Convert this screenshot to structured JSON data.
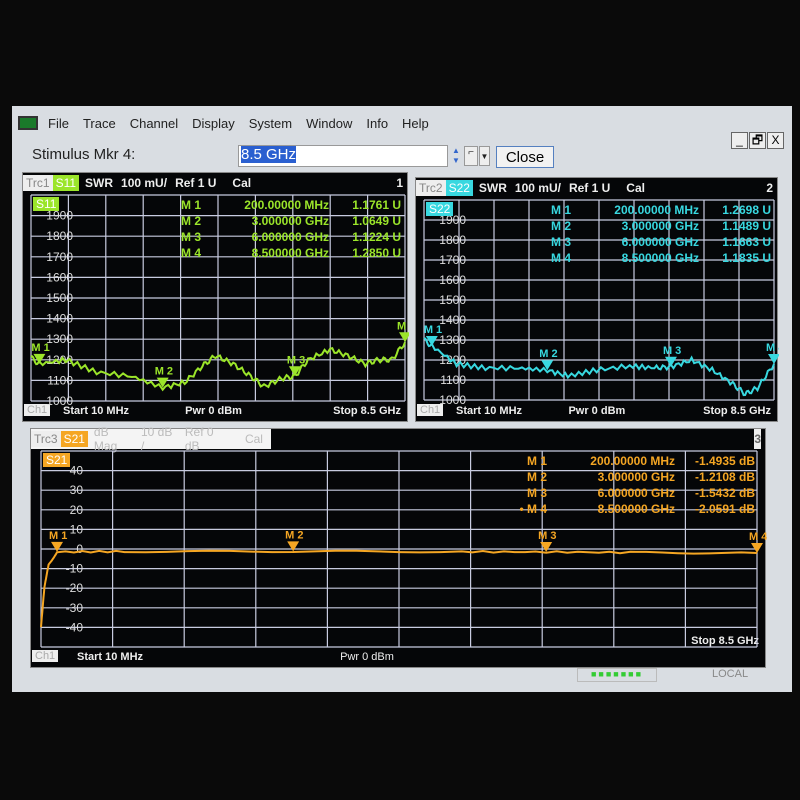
{
  "menu": {
    "items": [
      "File",
      "Trace",
      "Channel",
      "Display",
      "System",
      "Window",
      "Info",
      "Help"
    ]
  },
  "window_controls": {
    "minimize": "_",
    "restore": "🗗",
    "close": "X"
  },
  "toolbar": {
    "label": "Stimulus Mkr 4:",
    "value": "8.5 GHz",
    "close_label": "Close"
  },
  "panels": [
    {
      "trace": "Trc1",
      "param": "S11",
      "format": "SWR",
      "scale": "100 mU/",
      "ref": "Ref 1 U",
      "cal": "Cal",
      "number": "1",
      "color": "#9be52a",
      "yticks": [
        "1900",
        "1800",
        "1700",
        "1600",
        "1500",
        "1400",
        "1300",
        "1200",
        "1100",
        "1000"
      ],
      "markers": [
        {
          "name": "M 1",
          "stim": "200.00000 MHz",
          "value": "1.1761 U"
        },
        {
          "name": "M 2",
          "stim": "3.000000 GHz",
          "value": "1.0649 U"
        },
        {
          "name": "M 3",
          "stim": "6.000000 GHz",
          "value": "1.1224 U"
        },
        {
          "name": "M 4",
          "stim": "8.500000 GHz",
          "value": "1.2850 U"
        }
      ],
      "footer": {
        "ch": "Ch1",
        "start": "Start  10 MHz",
        "pwr": "Pwr  0 dBm",
        "stop": "Stop  8.5 GHz"
      }
    },
    {
      "trace": "Trc2",
      "param": "S22",
      "format": "SWR",
      "scale": "100 mU/",
      "ref": "Ref 1 U",
      "cal": "Cal",
      "number": "2",
      "color": "#38d8e0",
      "yticks": [
        "1900",
        "1800",
        "1700",
        "1600",
        "1500",
        "1400",
        "1300",
        "1200",
        "1100",
        "1000"
      ],
      "markers": [
        {
          "name": "M 1",
          "stim": "200.00000 MHz",
          "value": "1.2698 U"
        },
        {
          "name": "M 2",
          "stim": "3.000000 GHz",
          "value": "1.1489 U"
        },
        {
          "name": "M 3",
          "stim": "6.000000 GHz",
          "value": "1.1663 U"
        },
        {
          "name": "M 4",
          "stim": "8.500000 GHz",
          "value": "1.1835 U"
        }
      ],
      "footer": {
        "ch": "Ch1",
        "start": "Start  10 MHz",
        "pwr": "Pwr  0 dBm",
        "stop": "Stop  8.5 GHz"
      }
    },
    {
      "trace": "Trc3",
      "param": "S21",
      "format": "dB Mag",
      "scale": "10 dB /",
      "ref": "Ref 0 dB",
      "cal": "Cal",
      "number": "3",
      "color": "#f5a623",
      "yticks": [
        "40",
        "30",
        "20",
        "10",
        "0",
        "-10",
        "-20",
        "-30",
        "-40"
      ],
      "markers": [
        {
          "name": "M 1",
          "stim": "200.00000 MHz",
          "value": "-1.4935  dB"
        },
        {
          "name": "M 2",
          "stim": "3.000000 GHz",
          "value": "-1.2108  dB"
        },
        {
          "name": "M 3",
          "stim": "6.000000 GHz",
          "value": "-1.5432  dB"
        },
        {
          "name": "• M 4",
          "stim": "8.500000 GHz",
          "value": "-2.0591  dB"
        }
      ],
      "footer": {
        "ch": "Ch1",
        "start": "Start  10 MHz",
        "pwr": "Pwr  0 dBm",
        "stop": "Stop  8.5 GHz"
      }
    }
  ],
  "chart_data": [
    {
      "type": "line",
      "series": [
        {
          "name": "S11",
          "x_ghz": [
            0.01,
            0.2,
            0.8,
            1.5,
            2.3,
            3.0,
            3.5,
            3.9,
            4.2,
            4.6,
            5.0,
            5.3,
            5.7,
            6.0,
            6.3,
            6.8,
            7.2,
            7.6,
            7.9,
            8.2,
            8.5
          ],
          "y": [
            1.21,
            1.18,
            1.2,
            1.14,
            1.12,
            1.065,
            1.09,
            1.17,
            1.22,
            1.18,
            1.12,
            1.07,
            1.11,
            1.12,
            1.2,
            1.25,
            1.22,
            1.18,
            1.2,
            1.2,
            1.285
          ]
        }
      ],
      "xlim": [
        0.01,
        8.5
      ],
      "ylim": [
        1.0,
        2.0
      ]
    },
    {
      "type": "line",
      "series": [
        {
          "name": "S22",
          "x_ghz": [
            0.01,
            0.2,
            0.8,
            1.5,
            2.3,
            3.0,
            3.5,
            4.2,
            5.0,
            5.6,
            6.0,
            6.5,
            7.0,
            7.5,
            7.8,
            8.1,
            8.5
          ],
          "y": [
            1.3,
            1.27,
            1.18,
            1.16,
            1.16,
            1.149,
            1.12,
            1.15,
            1.17,
            1.16,
            1.166,
            1.2,
            1.15,
            1.08,
            1.03,
            1.06,
            1.18
          ]
        }
      ],
      "xlim": [
        0.01,
        8.5
      ],
      "ylim": [
        1.0,
        2.0
      ]
    },
    {
      "type": "line",
      "series": [
        {
          "name": "S21",
          "x_ghz": [
            0.01,
            0.05,
            0.1,
            0.2,
            1,
            3,
            5,
            6,
            7,
            8.5
          ],
          "y": [
            -40,
            -20,
            -8,
            -1.49,
            -1.3,
            -1.21,
            -1.4,
            -1.54,
            -1.8,
            -2.06
          ]
        }
      ],
      "xlim": [
        0.01,
        8.5
      ],
      "ylim": [
        -50,
        50
      ]
    }
  ],
  "status": {
    "leds": "■■■■■■■",
    "mode": "LOCAL"
  }
}
